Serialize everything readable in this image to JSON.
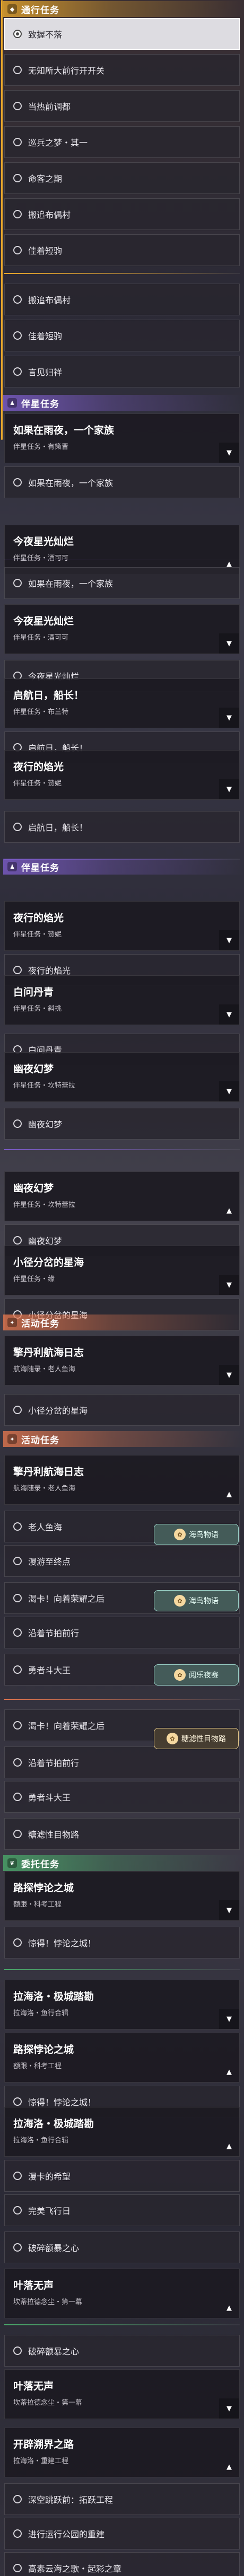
{
  "colors": {
    "orange": "#e7a62c",
    "purple": "#7c5cc9",
    "coral": "#e2764e",
    "green": "#4aa86a",
    "selected_bg": "#ebebf0",
    "card_bg": "#1c1a22"
  },
  "icons": {
    "main": "diamond-icon",
    "companion": "person-icon",
    "event": "flame-icon",
    "errand": "leaf-icon",
    "dropdown": "chevron-down-icon",
    "collapse": "chevron-up-icon",
    "hand": "hand-icon"
  },
  "headers": [
    {
      "id": "main",
      "label": "通行任务",
      "glyph": "◆",
      "color": "#e7a62c",
      "bar": "orange"
    },
    {
      "id": "companion",
      "label": "伴星任务",
      "glyph": "♟",
      "color": "#7c5cc9",
      "bar": "purple"
    },
    {
      "id": "event",
      "label": "活动任务",
      "glyph": "✦",
      "color": "#e2764e",
      "bar": "coral"
    },
    {
      "id": "event2",
      "label": "活动任务",
      "glyph": "✦",
      "color": "#e2764e",
      "bar": "coral"
    },
    {
      "id": "errand",
      "label": "委托任务",
      "glyph": "❦",
      "color": "#4aa86a",
      "bar": "green"
    }
  ],
  "subtasks": [
    {
      "label": "致握不落",
      "selected": true
    },
    {
      "label": "无知所大前行开开关"
    },
    {
      "label": "当热前调都"
    },
    {
      "label": "巡兵之梦・其一"
    },
    {
      "label": "命客之期"
    },
    {
      "label": "搬追布偶村"
    },
    {
      "label": "佳着短驹"
    },
    {
      "label": "搬追布偶村"
    },
    {
      "label": "佳着短驹"
    },
    {
      "label": "言见归祥"
    },
    {
      "label": "如果在雨夜，一个家族"
    },
    {
      "label": "如果在雨夜，一个家族"
    },
    {
      "label": "今夜星光灿烂"
    },
    {
      "label": "启航日，船长！"
    },
    {
      "label": "启航日，船长！"
    },
    {
      "label": "夜行的焰光"
    },
    {
      "label": "白问丹青"
    },
    {
      "label": "幽夜幻梦"
    },
    {
      "label": "幽夜幻梦"
    },
    {
      "label": "小径分岔的星海"
    },
    {
      "label": "小径分岔的星海"
    },
    {
      "label": "老人鱼海"
    },
    {
      "label": "漫游至终点"
    },
    {
      "label": "渴卡！向着荣耀之后"
    },
    {
      "label": "沿着节拍前行"
    },
    {
      "label": "勇者斗大王"
    },
    {
      "label": "渴卡！向着荣耀之后"
    },
    {
      "label": "沿着节拍前行"
    },
    {
      "label": "勇者斗大王"
    },
    {
      "label": "糖滤性目物路"
    },
    {
      "label": "惊得！悖论之城！"
    },
    {
      "label": "惊得！悖论之城！"
    },
    {
      "label": "漫卡的希望"
    },
    {
      "label": "完美飞行日"
    },
    {
      "label": "破碎额暴之心"
    },
    {
      "label": "破碎额暴之心"
    },
    {
      "label": "深空跳跃前：拓跃工程"
    },
    {
      "label": "进行运行公园的重建"
    },
    {
      "label": "高素云海之歌・起彩之章"
    }
  ],
  "quests": [
    {
      "title": "如果在雨夜，一个家族",
      "sub": "伴星任务・有策晋"
    },
    {
      "title": "今夜星光灿烂",
      "sub": "伴星任务・酒可可"
    },
    {
      "title": "今夜星光灿烂",
      "sub": "伴星任务・酒可可"
    },
    {
      "title": "启航日，船长！",
      "sub": "伴星任务・布兰特"
    },
    {
      "title": "夜行的焰光",
      "sub": "伴星任务・赞妮"
    },
    {
      "title": "夜行的焰光",
      "sub": "伴星任务・赞妮"
    },
    {
      "title": "白问丹青",
      "sub": "伴星任务・斜挑"
    },
    {
      "title": "幽夜幻梦",
      "sub": "伴星任务・坎特蕾拉"
    },
    {
      "title": "幽夜幻梦",
      "sub": "伴星任务・坎特蕾拉"
    },
    {
      "title": "小径分岔的星海",
      "sub": "伴星任务・缘"
    },
    {
      "title": "擎丹利航海日志",
      "sub": "航海随录・老人鱼海"
    },
    {
      "title": "擎丹利航海日志",
      "sub": "航海随录・老人鱼海"
    },
    {
      "title": "路探悖论之城",
      "sub": "额跟・科考工程"
    },
    {
      "title": "拉海洛・极城踏勘",
      "sub": "拉海洛・鱼行合辑"
    },
    {
      "title": "路探悖论之城",
      "sub": "额跟・科考工程"
    },
    {
      "title": "拉海洛・极城踏勘",
      "sub": "拉海洛・鱼行合辑"
    },
    {
      "title": "叶落无声",
      "sub": "坎蒂拉德念尘・第一幕"
    },
    {
      "title": "叶落无声",
      "sub": "坎蒂拉德念尘・第一幕"
    },
    {
      "title": "开辟溯界之路",
      "sub": "拉海洛・重建工程"
    }
  ],
  "badges": [
    {
      "label": "海鸟物语",
      "icon": "bird-icon"
    },
    {
      "label": "海鸟物语",
      "icon": "bird-icon"
    },
    {
      "label": "阅乐夜赛",
      "icon": "night-icon"
    },
    {
      "label": "糖滤性目物路",
      "icon": "hand-icon"
    }
  ]
}
